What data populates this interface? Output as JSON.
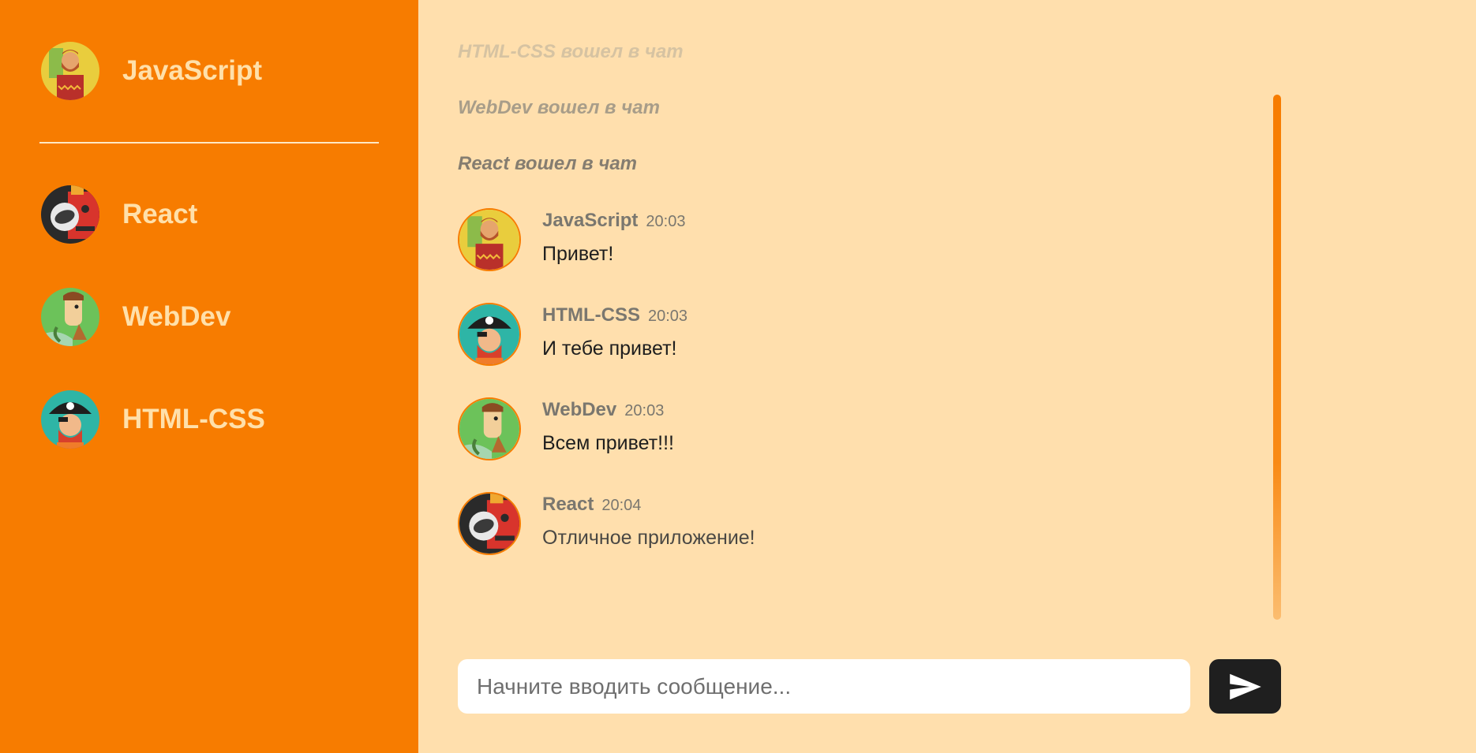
{
  "sidebar": {
    "current_user": {
      "name": "JavaScript",
      "avatar_icon": "bearded-hiker-avatar-icon"
    },
    "users": [
      {
        "name": "React",
        "avatar_icon": "robot-astronaut-avatar-icon"
      },
      {
        "name": "WebDev",
        "avatar_icon": "green-adventurer-avatar-icon"
      },
      {
        "name": "HTML-CSS",
        "avatar_icon": "pirate-avatar-icon"
      }
    ]
  },
  "chat": {
    "system_messages": [
      "HTML-CSS вошел в чат",
      "WebDev вошел в чат",
      "React вошел в чат"
    ],
    "messages": [
      {
        "author": "JavaScript",
        "time": "20:03",
        "text": "Привет!"
      },
      {
        "author": "HTML-CSS",
        "time": "20:03",
        "text": "И тебе привет!"
      },
      {
        "author": "WebDev",
        "time": "20:03",
        "text": "Всем привет!!!"
      },
      {
        "author": "React",
        "time": "20:04",
        "text": "Отличное приложение!"
      }
    ],
    "composer": {
      "value": "",
      "placeholder": "Начните вводить сообщение..."
    },
    "send_icon": "paper-plane-icon"
  },
  "colors": {
    "sidebar_bg": "#f77c00",
    "chat_bg": "#ffdfad",
    "accent": "#f77c00",
    "send_button": "#1f1f1f"
  }
}
